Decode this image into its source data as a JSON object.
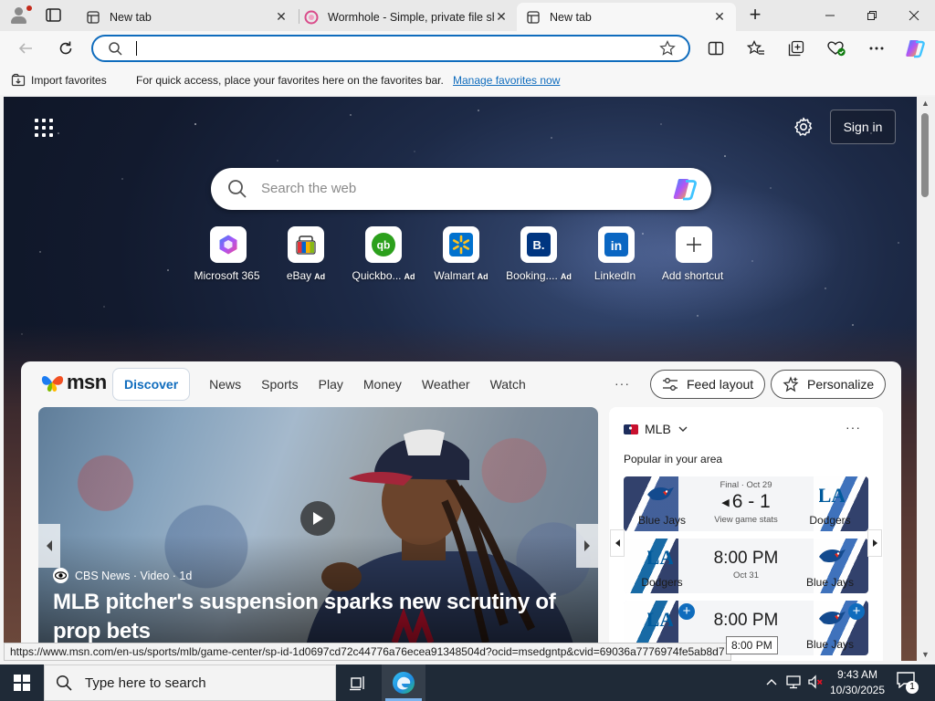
{
  "browser": {
    "tabs": [
      {
        "title": "New tab",
        "active": false
      },
      {
        "title": "Wormhole - Simple, private file sh",
        "active": false
      },
      {
        "title": "New tab",
        "active": true
      }
    ],
    "address": {
      "value": ""
    },
    "favorites_bar": {
      "import_label": "Import favorites",
      "message": "For quick access, place your favorites here on the favorites bar.",
      "manage_link": "Manage favorites now"
    }
  },
  "newtab": {
    "sign_in": "Sign in",
    "search_placeholder": "Search the web",
    "shortcuts": [
      {
        "label": "Microsoft 365",
        "ad": ""
      },
      {
        "label": "eBay",
        "ad": "Ad"
      },
      {
        "label": "Quickbo...",
        "ad": "Ad"
      },
      {
        "label": "Walmart",
        "ad": "Ad"
      },
      {
        "label": "Booking....",
        "ad": "Ad"
      },
      {
        "label": "LinkedIn",
        "ad": ""
      },
      {
        "label": "Add shortcut",
        "ad": ""
      }
    ]
  },
  "feed": {
    "brand": "msn",
    "nav": [
      "Discover",
      "News",
      "Sports",
      "Play",
      "Money",
      "Weather",
      "Watch"
    ],
    "more": "···",
    "feed_layout": "Feed layout",
    "personalize": "Personalize",
    "hero": {
      "source": "CBS News · Video · 1d",
      "headline": "MLB pitcher's suspension sparks new scrutiny of prop bets"
    },
    "mlb": {
      "title": "MLB",
      "subtitle": "Popular in your area",
      "games": [
        {
          "left_team": "Blue Jays",
          "right_team": "Dodgers",
          "status": "Final · Oct 29",
          "main": "6 - 1",
          "sub": "View game stats"
        },
        {
          "left_team": "Dodgers",
          "right_team": "Blue Jays",
          "status": "",
          "main": "8:00 PM",
          "sub": "Oct 31"
        },
        {
          "left_team": "",
          "right_team": "Blue Jays",
          "status": "",
          "main": "8:00 PM",
          "sub": ""
        }
      ]
    }
  },
  "status_url": "https://www.msn.com/en-us/sports/mlb/game-center/sp-id-1d0697cd72c44776a76ecea91348504d?ocid=msedgntp&cvid=69036a7776974fe5ab8d7",
  "tooltip": "8:00 PM",
  "taskbar": {
    "search_placeholder": "Type here to search",
    "time": "9:43 AM",
    "date": "10/30/2025",
    "notifications": "1"
  },
  "colors": {
    "accent": "#0f6cbd",
    "taskbar": "#1f2a37",
    "brand_blue": "#1b4f9c"
  }
}
